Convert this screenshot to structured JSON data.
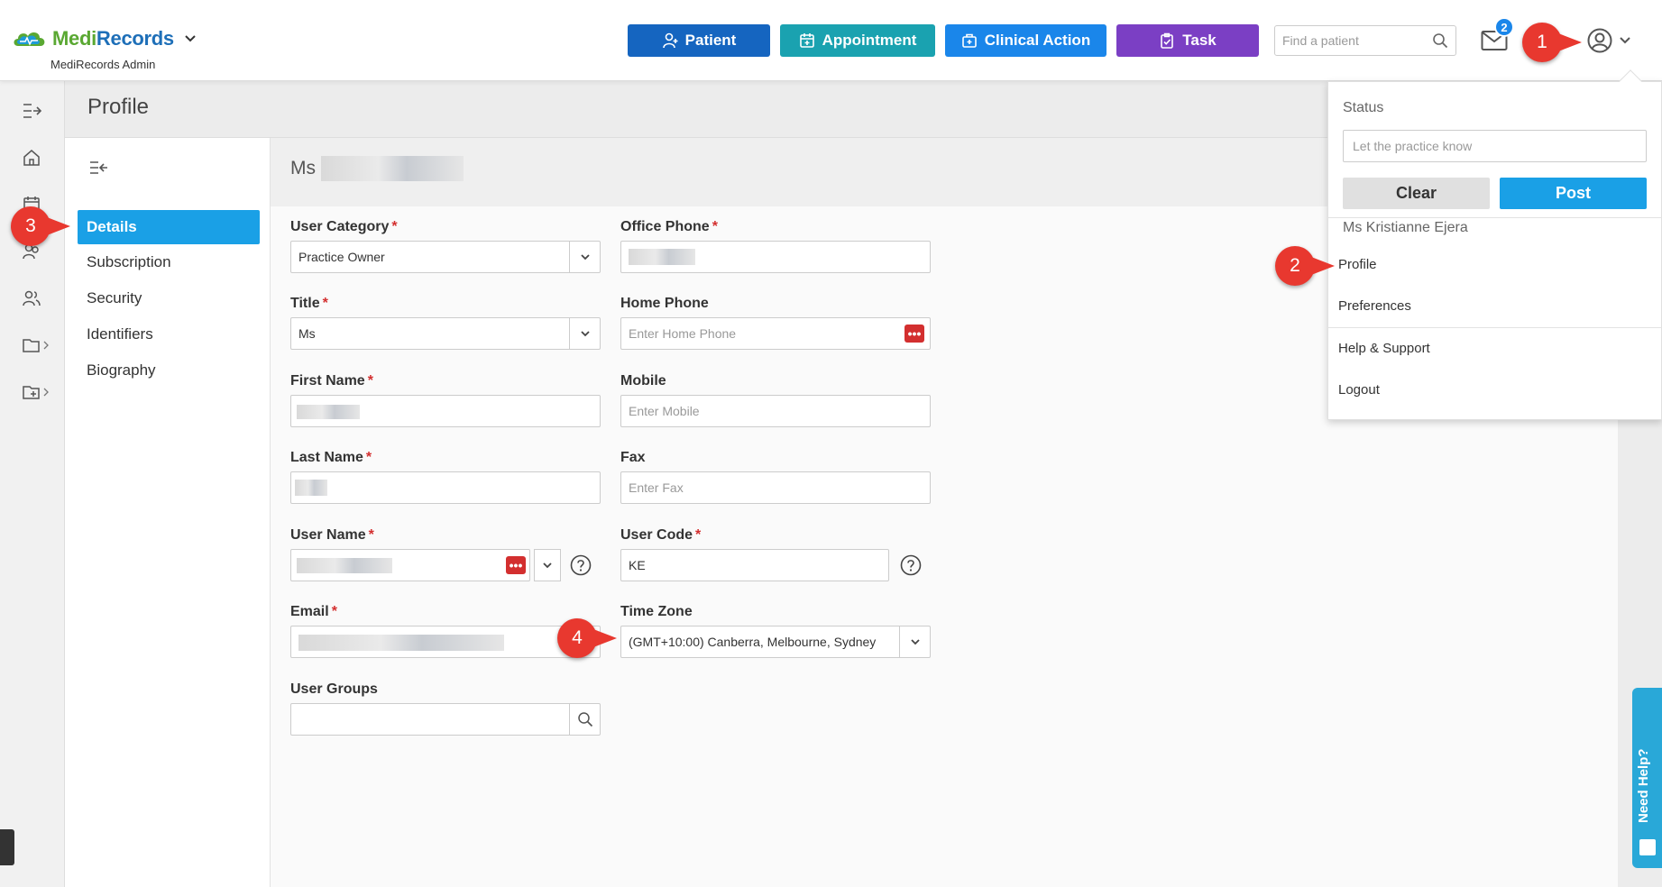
{
  "header": {
    "brand_part1": "Medi",
    "brand_part2": "Records",
    "brand_sub": "MediRecords Admin",
    "buttons": {
      "patient": "Patient",
      "appointment": "Appointment",
      "clinical_action": "Clinical Action",
      "task": "Task"
    },
    "search_placeholder": "Find a patient",
    "mail_count": "2"
  },
  "page": {
    "title": "Profile",
    "name_prefix": "Ms"
  },
  "subnav": {
    "items": [
      {
        "label": "Details",
        "active": true
      },
      {
        "label": "Subscription"
      },
      {
        "label": "Security"
      },
      {
        "label": "Identifiers"
      },
      {
        "label": "Biography"
      }
    ]
  },
  "form": {
    "user_category": {
      "label": "User Category",
      "value": "Practice Owner"
    },
    "office_phone": {
      "label": "Office Phone"
    },
    "title": {
      "label": "Title",
      "value": "Ms"
    },
    "home_phone": {
      "label": "Home Phone",
      "placeholder": "Enter Home Phone"
    },
    "first_name": {
      "label": "First Name"
    },
    "mobile": {
      "label": "Mobile",
      "placeholder": "Enter Mobile"
    },
    "last_name": {
      "label": "Last Name"
    },
    "fax": {
      "label": "Fax",
      "placeholder": "Enter Fax"
    },
    "user_name": {
      "label": "User Name"
    },
    "user_code": {
      "label": "User Code",
      "value": "KE"
    },
    "email": {
      "label": "Email"
    },
    "time_zone": {
      "label": "Time Zone",
      "value": "(GMT+10:00) Canberra, Melbourne, Sydney"
    },
    "user_groups": {
      "label": "User Groups"
    },
    "required_mark": "*",
    "dots": "•••"
  },
  "dropdown": {
    "status_label": "Status",
    "status_placeholder": "Let the practice know",
    "clear": "Clear",
    "post": "Post",
    "user_name": "Ms Kristianne Ejera",
    "items": [
      "Profile",
      "Preferences",
      "Help & Support",
      "Logout"
    ]
  },
  "need_help": "Need Help?",
  "callouts": [
    "1",
    "2",
    "3",
    "4"
  ],
  "colors": {
    "patient": "#1565c0",
    "appointment": "#1aa2b0",
    "clinical_action": "#1a86ea",
    "task": "#7b3fc4",
    "active_nav": "#1aa0e6",
    "callout": "#e8382f"
  }
}
